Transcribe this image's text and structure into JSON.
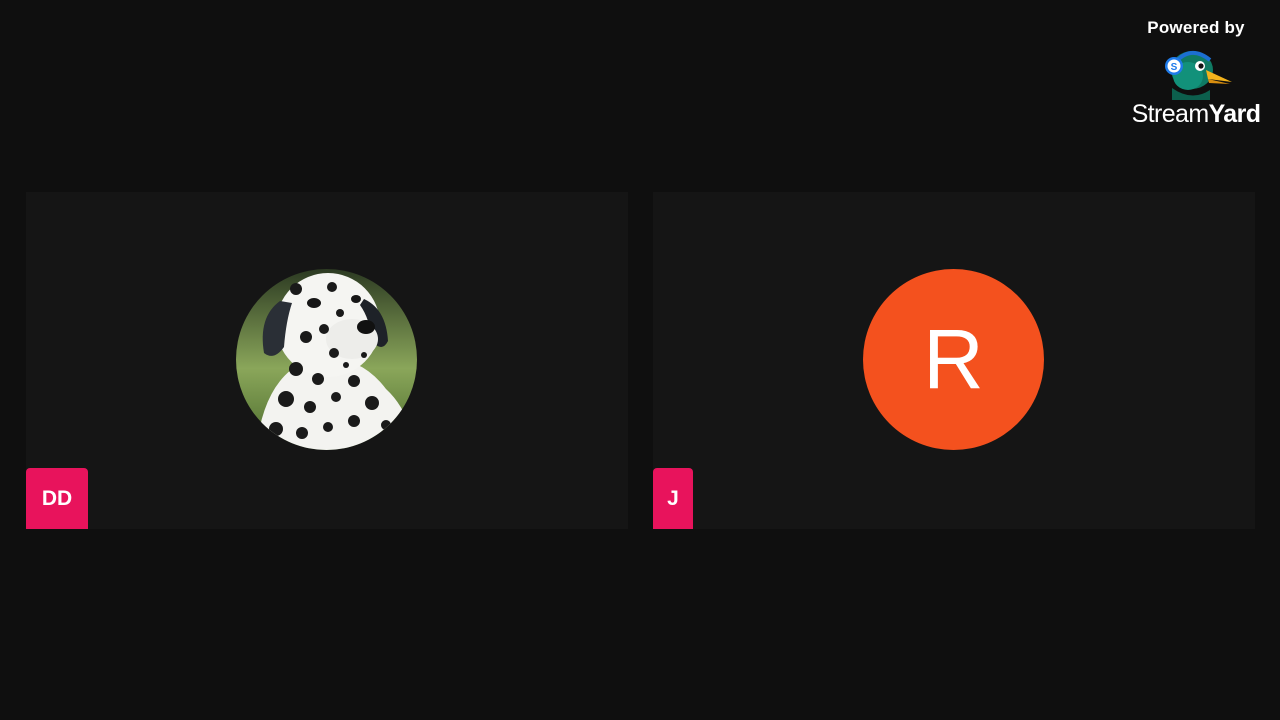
{
  "branding": {
    "powered_by": "Powered by",
    "brand_light": "Stream",
    "brand_bold": "Yard",
    "logo_icon": "streamyard-duck-logo",
    "logo_badge_letter": "S"
  },
  "participants": [
    {
      "name_tag": "DD",
      "avatar_type": "photo",
      "avatar_icon": "dalmatian-dog-photo"
    },
    {
      "name_tag": "J",
      "avatar_type": "initial",
      "avatar_letter": "R",
      "avatar_color": "#f4511e"
    }
  ],
  "colors": {
    "background": "#0f0f0f",
    "tile": "#151515",
    "name_tag": "#e8135c"
  }
}
